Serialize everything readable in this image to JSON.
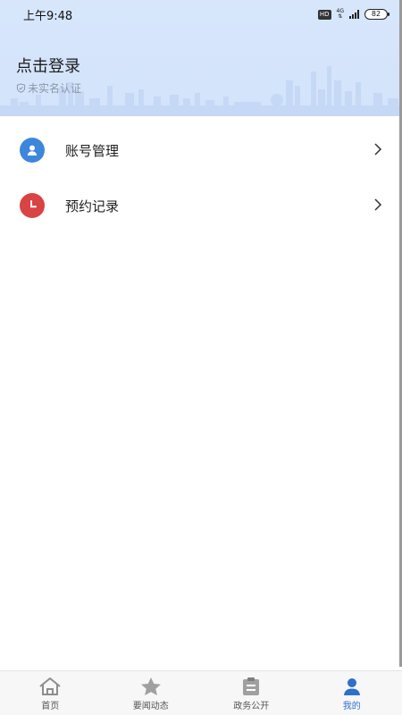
{
  "status": {
    "time": "上午9:48",
    "hd": "HD",
    "network": "4G",
    "battery": "82"
  },
  "header": {
    "login": "点击登录",
    "verify": "未实名认证"
  },
  "menu": [
    {
      "label": "账号管理",
      "icon": "user-icon",
      "color": "#3d86dc"
    },
    {
      "label": "预约记录",
      "icon": "clock-icon",
      "color": "#d94343"
    }
  ],
  "tabs": [
    {
      "label": "首页",
      "icon": "home-icon"
    },
    {
      "label": "要闻动态",
      "icon": "star-icon"
    },
    {
      "label": "政务公开",
      "icon": "clipboard-icon"
    },
    {
      "label": "我的",
      "icon": "profile-icon",
      "active": true
    }
  ],
  "colors": {
    "header_bg": "#d5e4fb",
    "accent": "#2f6fc9"
  }
}
